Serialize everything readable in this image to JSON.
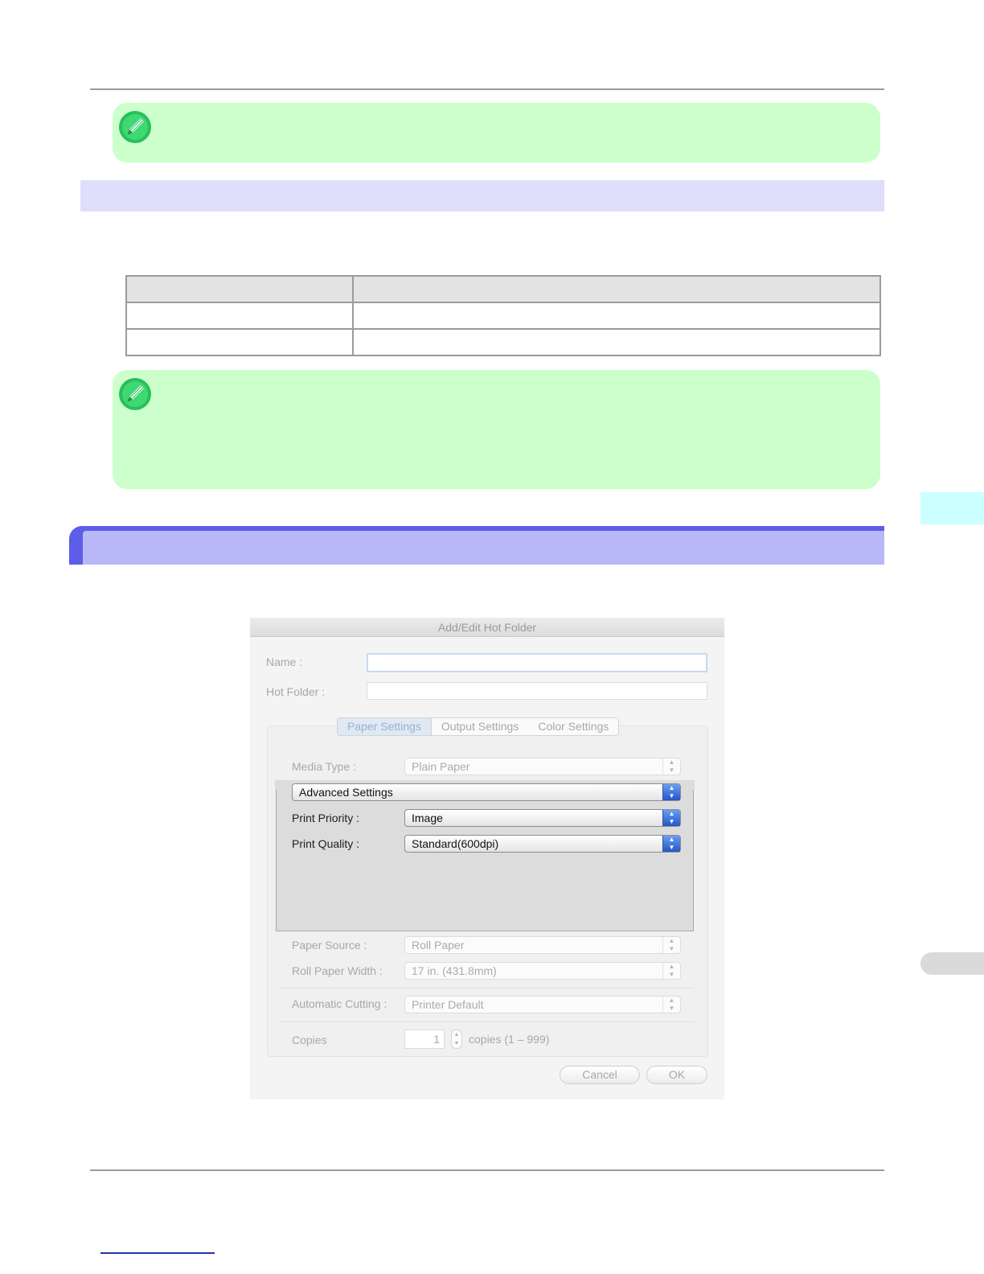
{
  "dialog": {
    "title": "Add/Edit Hot Folder",
    "name_label": "Name :",
    "name_value": "",
    "hot_folder_label": "Hot Folder :",
    "hot_folder_value": "",
    "tabs": [
      "Paper Settings",
      "Output Settings",
      "Color Settings"
    ],
    "active_tab": "Paper Settings",
    "media_type_label": "Media Type :",
    "media_type_value": "Plain Paper",
    "advanced_settings": "Advanced Settings",
    "print_priority_label": "Print Priority :",
    "print_priority_value": "Image",
    "print_quality_label": "Print Quality :",
    "print_quality_value": "Standard(600dpi)",
    "paper_source_label": "Paper Source :",
    "paper_source_value": "Roll Paper",
    "roll_width_label": "Roll Paper Width :",
    "roll_width_value": "17 in. (431.8mm)",
    "auto_cut_label": "Automatic Cutting :",
    "auto_cut_value": "Printer Default",
    "copies_label": "Copies",
    "copies_value": "1",
    "copies_range": "copies (1 – 999)",
    "cancel_label": "Cancel",
    "ok_label": "OK"
  },
  "colors": {
    "note_bg": "#ccffcc",
    "section_band": "#dfdffb",
    "heading_band": "#b8b8f8",
    "heading_edge": "#5d5de8",
    "side_tab": "#ccffff"
  },
  "icons": {
    "note": "pencil-note-icon",
    "stepper": "up-down-stepper-icon",
    "popup": "popup-arrows-icon"
  }
}
